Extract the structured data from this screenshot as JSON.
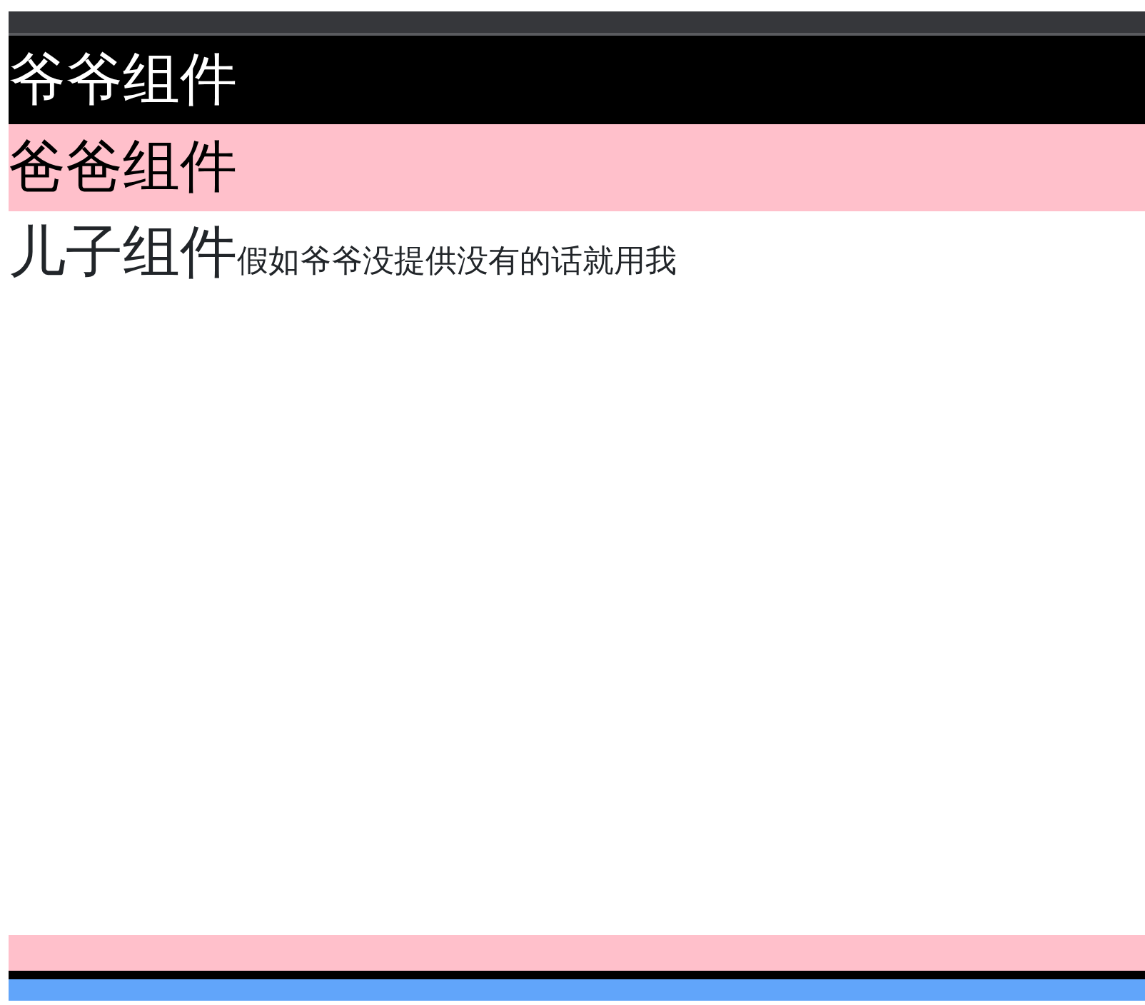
{
  "grandpa": {
    "title": "爷爷组件"
  },
  "father": {
    "title": "爸爸组件"
  },
  "son": {
    "title": "儿子组件",
    "fallback_text": "假如爷爷没提供没有的话就用我"
  }
}
